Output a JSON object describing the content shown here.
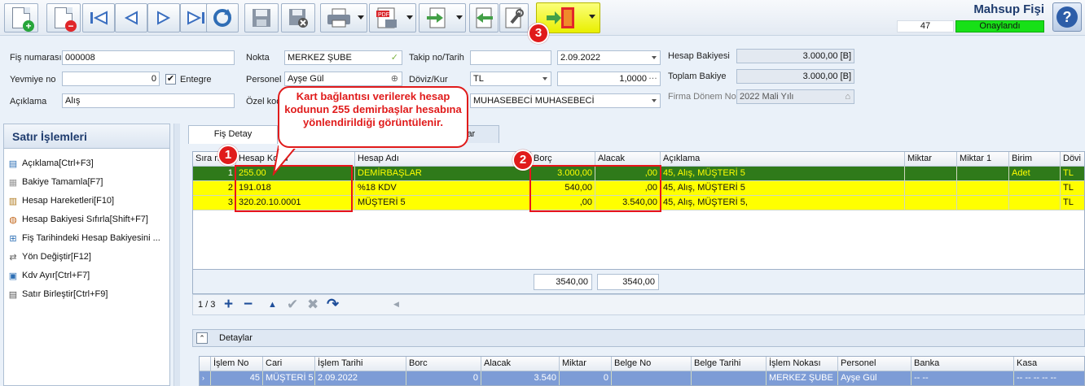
{
  "window": {
    "title": "Mahsup Fişi",
    "record_number": "47",
    "status": "Onaylandı"
  },
  "toolbar": {
    "buttons": [
      "new-document",
      "delete-document",
      "first-record",
      "previous-record",
      "next-record",
      "last-record",
      "refresh",
      "save",
      "save-cancel",
      "print",
      "pdf-export",
      "export",
      "import",
      "tools",
      "exit"
    ]
  },
  "form": {
    "fis_numarasi": {
      "label": "Fiş numarası",
      "value": "000008"
    },
    "yevmiye_no": {
      "label": "Yevmiye no",
      "value": "0"
    },
    "entegre": {
      "label": "Entegre",
      "checked": "✔"
    },
    "aciklama": {
      "label": "Açıklama",
      "value": "Alış"
    },
    "nokta": {
      "label": "Nokta",
      "value": "MERKEZ ŞUBE"
    },
    "personel": {
      "label": "Personel",
      "value": "Ayşe Gül"
    },
    "ozel_kod": {
      "label": "Özel kod"
    },
    "takip_no": {
      "label": "Takip no/Tarih",
      "value": ""
    },
    "tarih": {
      "value": "2.09.2022"
    },
    "doviz_kur": {
      "label": "Döviz/Kur",
      "currency": "TL",
      "rate": "1,0000"
    },
    "muhasebeci": {
      "value": "MUHASEBECİ MUHASEBECİ"
    },
    "hesap_bakiyesi": {
      "label": "Hesap Bakiyesi",
      "value": "3.000,00 [B]"
    },
    "toplam_bakiye": {
      "label": "Toplam Bakiye",
      "value": "3.000,00 [B]"
    },
    "firma_donem": {
      "label": "Firma Dönem No",
      "value": "2022 Mali Yılı"
    }
  },
  "left_panel": {
    "title": "Satır İşlemleri",
    "items": [
      "Açıklama[Ctrl+F3]",
      "Bakiye Tamamla[F7]",
      "Hesap Hareketleri[F10]",
      "Hesap Bakiyesi Sıfırla[Shift+F7]",
      "Fiş Tarihindeki Hesap Bakiyesini ...",
      "Yön Değiştir[F12]",
      "Kdv Ayır[Ctrl+F7]",
      "Satır Birleştir[Ctrl+F9]"
    ]
  },
  "tabs": {
    "fis_detay": "Fiş Detay",
    "second": "lar"
  },
  "grid": {
    "columns": [
      "Sıra n",
      "Hesap Kodu",
      "Hesap Adı",
      "Borç",
      "Alacak",
      "Açıklama",
      "Miktar",
      "Miktar 1",
      "Birim",
      "Dövi"
    ],
    "rows": [
      [
        "1",
        "255.00",
        "DEMİRBAŞLAR",
        "3.000,00",
        ",00",
        "45, Alış, MÜŞTERİ 5",
        "",
        "",
        "Adet",
        "TL"
      ],
      [
        "2",
        "191.018",
        "%18 KDV",
        "540,00",
        ",00",
        "45, Alış, MÜŞTERİ 5",
        "",
        "",
        "",
        "TL"
      ],
      [
        "3",
        "320.20.10.0001",
        "MÜŞTERİ 5",
        ",00",
        "3.540,00",
        "45, Alış, MÜŞTERİ 5,",
        "",
        "",
        "",
        "TL"
      ]
    ],
    "total_borc": "3540,00",
    "total_alacak": "3540,00"
  },
  "navigator": {
    "page": "1 / 3"
  },
  "detaylar": {
    "title": "Detaylar",
    "columns": [
      "İşlem No",
      "Cari",
      "İşlem Tarihi",
      "Borc",
      "Alacak",
      "Miktar",
      "Belge No",
      "Belge Tarihi",
      "İşlem Nokası",
      "Personel",
      "Banka",
      "Kasa"
    ],
    "row": [
      "45",
      "MÜŞTERİ 5",
      "2.09.2022",
      "0",
      "3.540",
      "0",
      "",
      "",
      "MERKEZ ŞUBE",
      "Ayşe Gül",
      "-- --",
      "-- -- -- -- --"
    ]
  },
  "annotations": {
    "callout": "Kart bağlantısı verilerek hesap kodunun 255 demirbaşlar hesabına yönlendirildiği görüntülenir.",
    "badge1": "1",
    "badge2": "2",
    "badge3": "3"
  },
  "colors": {
    "selected_row": "#2f7a1a",
    "highlight_row": "#ffff00",
    "status_green": "#17e017",
    "annotation_red": "#e01b1b"
  }
}
